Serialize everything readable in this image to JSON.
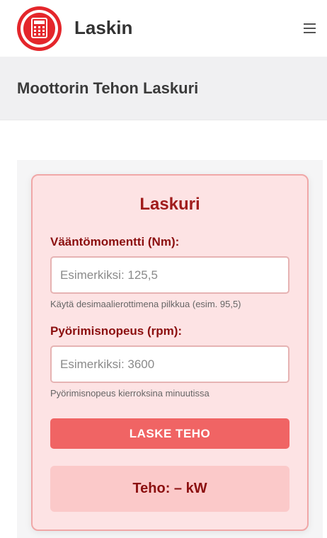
{
  "header": {
    "brand": "Laskin",
    "logo_icon": "calculator-icon",
    "menu_icon": "hamburger-menu-icon"
  },
  "page": {
    "title": "Moottorin Tehon Laskuri"
  },
  "calculator": {
    "title": "Laskuri",
    "torque": {
      "label": "Vääntömomentti (Nm):",
      "placeholder": "Esimerkiksi: 125,5",
      "value": "",
      "hint": "Käytä desimaalierottimena pilkkua (esim. 95,5)"
    },
    "rpm": {
      "label": "Pyörimisnopeus (rpm):",
      "placeholder": "Esimerkiksi: 3600",
      "value": "",
      "hint": "Pyörimisnopeus kierroksina minuutissa"
    },
    "button_label": "LASKE TEHO",
    "result_text": "Teho: – kW"
  },
  "colors": {
    "brand_red": "#e4262b",
    "card_bg": "#fde3e4",
    "button": "#f06464",
    "label_text": "#8b0f0f"
  }
}
